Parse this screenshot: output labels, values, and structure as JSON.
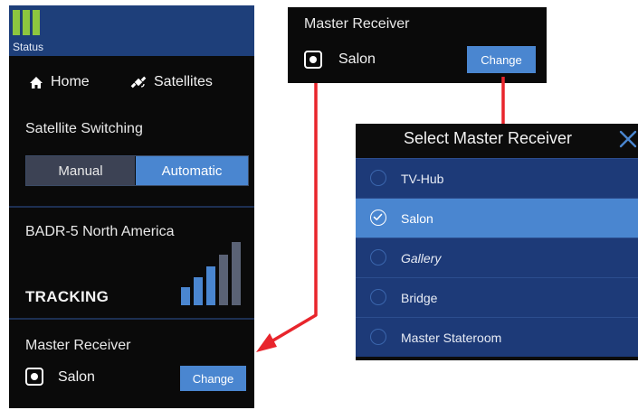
{
  "left_panel": {
    "status_label": "Status",
    "nav": [
      {
        "label": "Home",
        "icon": "home-icon"
      },
      {
        "label": "Satellites",
        "icon": "satellite-icon"
      }
    ],
    "satellite_switching_label": "Satellite Switching",
    "switch_options": [
      "Manual",
      "Automatic"
    ],
    "selected_switch": "Automatic",
    "satellite_name": "BADR-5 North America",
    "tracking_status": "TRACKING",
    "master_receiver": {
      "label": "Master Receiver",
      "selected": "Salon",
      "button": "Change"
    }
  },
  "master_receiver_panel": {
    "label": "Master Receiver",
    "selected": "Salon",
    "button": "Change"
  },
  "select_dialog": {
    "title": "Select Master Receiver",
    "close_icon": "close-icon",
    "options": [
      {
        "label": "TV-Hub",
        "selected": false
      },
      {
        "label": "Salon",
        "selected": true
      },
      {
        "label": "Gallery",
        "selected": false
      },
      {
        "label": "Bridge",
        "selected": false
      },
      {
        "label": "Master Stateroom",
        "selected": false
      }
    ]
  },
  "colors": {
    "panel_bg": "#0a0a0a",
    "status_bar": "#1e3f7a",
    "accent_blue": "#4a86d0",
    "list_blue": "#1d3a78",
    "status_green": "#8dc63f",
    "arrow_red": "#e8252c"
  },
  "signal_strength_bars": {
    "total": 5,
    "active": 3
  }
}
